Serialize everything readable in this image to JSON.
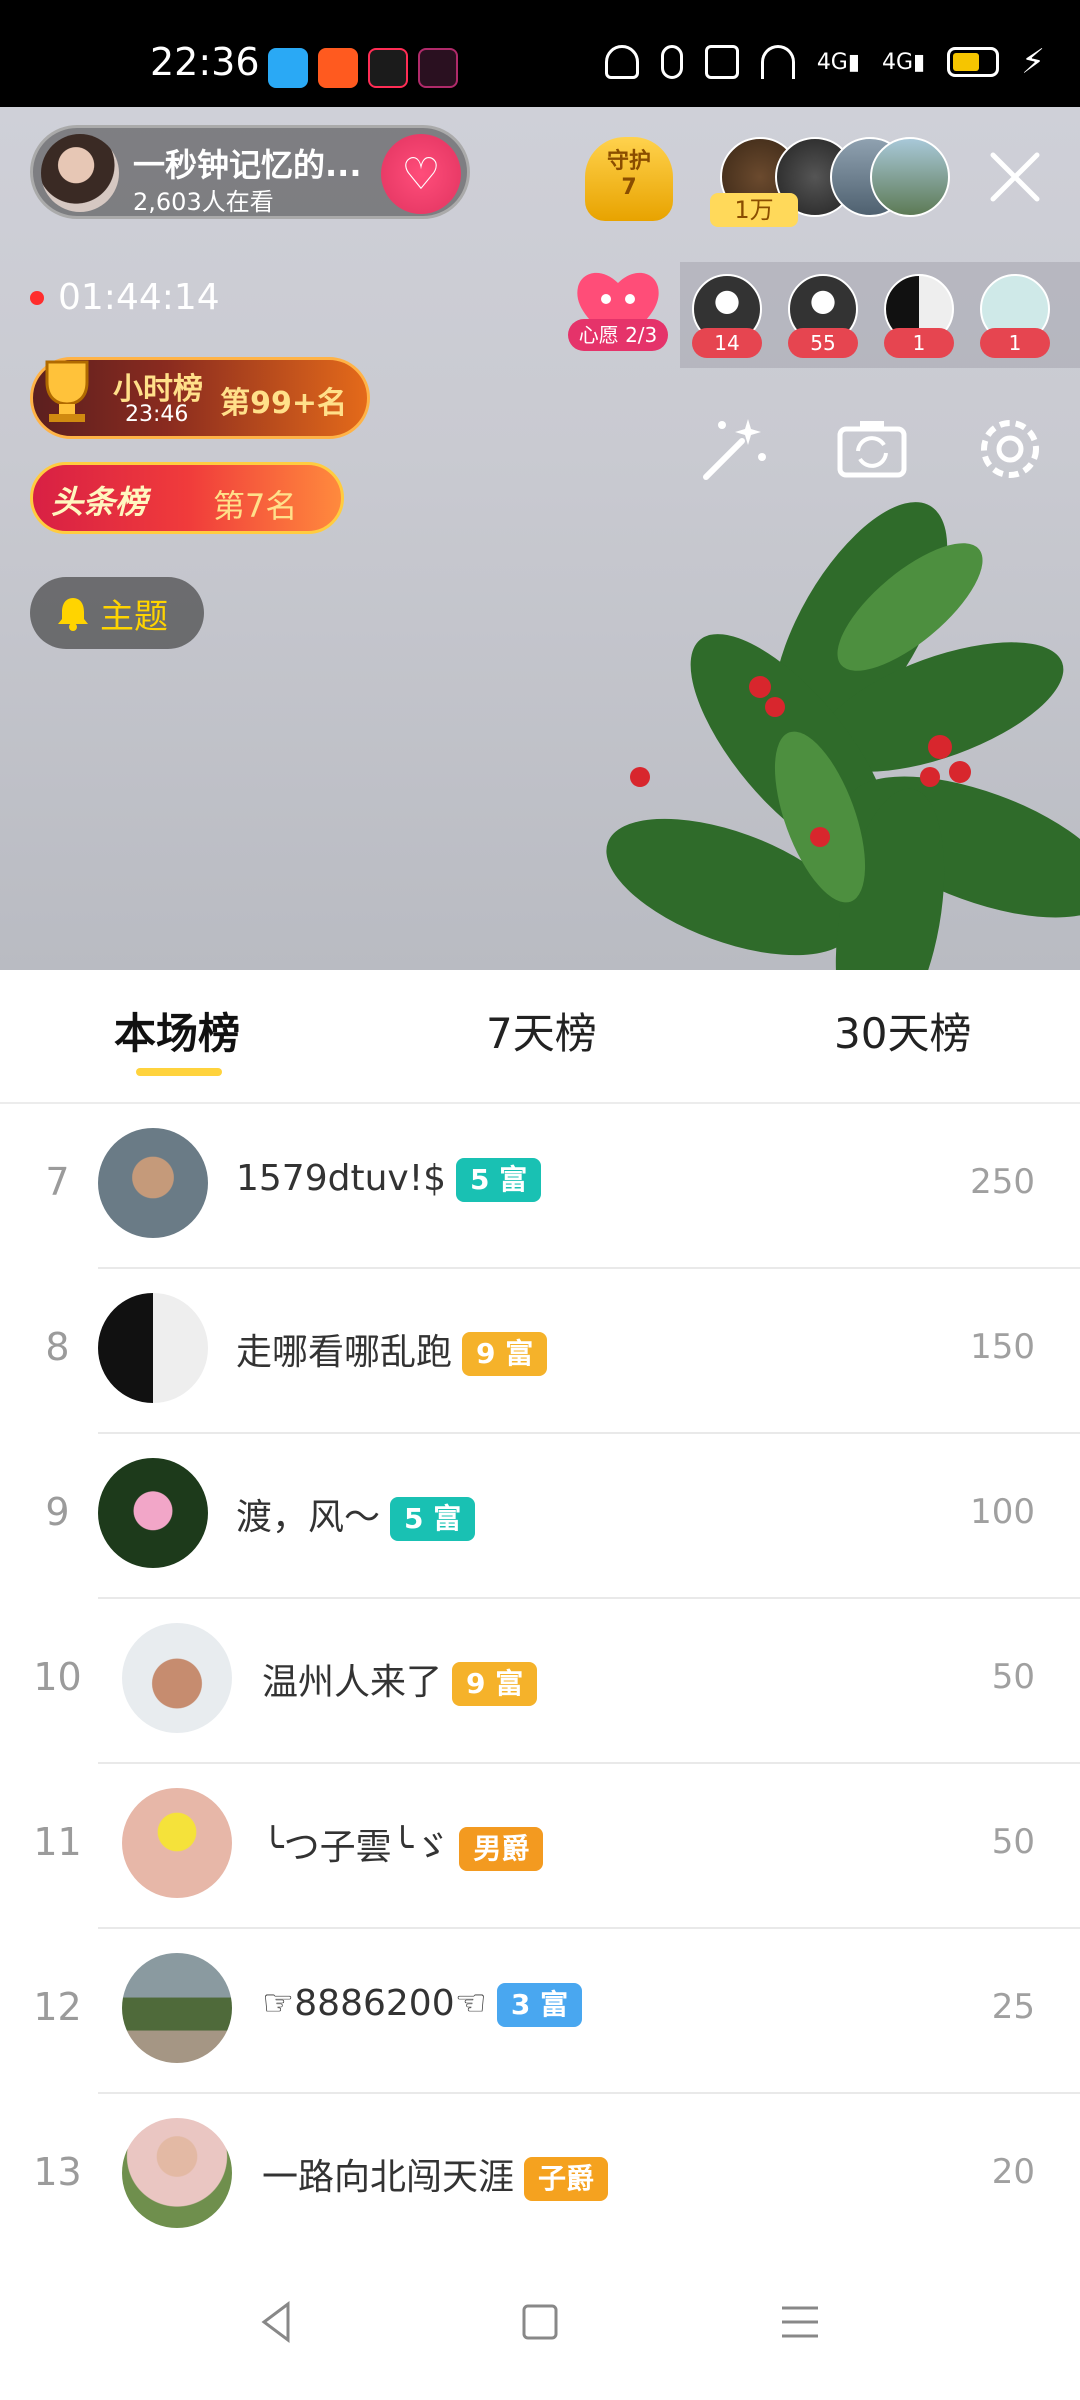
{
  "status_bar": {
    "time": "22:36",
    "icons": [
      "browser-icon",
      "kuaishou-icon",
      "douyin-icon",
      "douyin-lite-icon",
      "headphones-icon",
      "mic-icon",
      "camera-icon",
      "wifi-icon",
      "signal-4g-icon",
      "signal-4g-icon",
      "battery-icon",
      "charging-icon"
    ]
  },
  "live": {
    "host_name": "一秒钟记忆的...",
    "viewers": "2,603人在看",
    "guard_label": "守护",
    "guard_count": "7",
    "top_fans_badge": "1万",
    "timer": "01:44:14",
    "wish_label": "心愿 2/3",
    "rank_counts": [
      "14",
      "55",
      "1",
      "1"
    ],
    "hour_rank": {
      "title": "小时榜",
      "time": "23:46",
      "place": "第99+名"
    },
    "headline_rank": {
      "title": "头条榜",
      "place": "第7名"
    },
    "theme_label": "主题"
  },
  "tabs": [
    "本场榜",
    "7天榜",
    "30天榜"
  ],
  "active_tab": 0,
  "leaderboard": [
    {
      "rank": "7",
      "name": "1579dtuv!$",
      "badge": "5 富",
      "badge_color": "#19c1b3",
      "score": "250"
    },
    {
      "rank": "8",
      "name": "走哪看哪乱跑",
      "badge": "9 富",
      "badge_color": "#f5b22a",
      "score": "150"
    },
    {
      "rank": "9",
      "name": "渡，风～",
      "badge": "5 富",
      "badge_color": "#19c1b3",
      "score": "100"
    },
    {
      "rank": "10",
      "name": "温州人来了",
      "badge": "9 富",
      "badge_color": "#f5b22a",
      "score": "50"
    },
    {
      "rank": "11",
      "name": "╰つ子雲╰ゞ",
      "badge": "男爵",
      "badge_color": "#f39a20",
      "score": "50"
    },
    {
      "rank": "12",
      "name": "☞8886200☜",
      "badge": "3 富",
      "badge_color": "#49a7f0",
      "score": "25"
    },
    {
      "rank": "13",
      "name": "一路向北闯天涯",
      "badge": "子爵",
      "badge_color": "#f5a21f",
      "score": "20"
    }
  ]
}
